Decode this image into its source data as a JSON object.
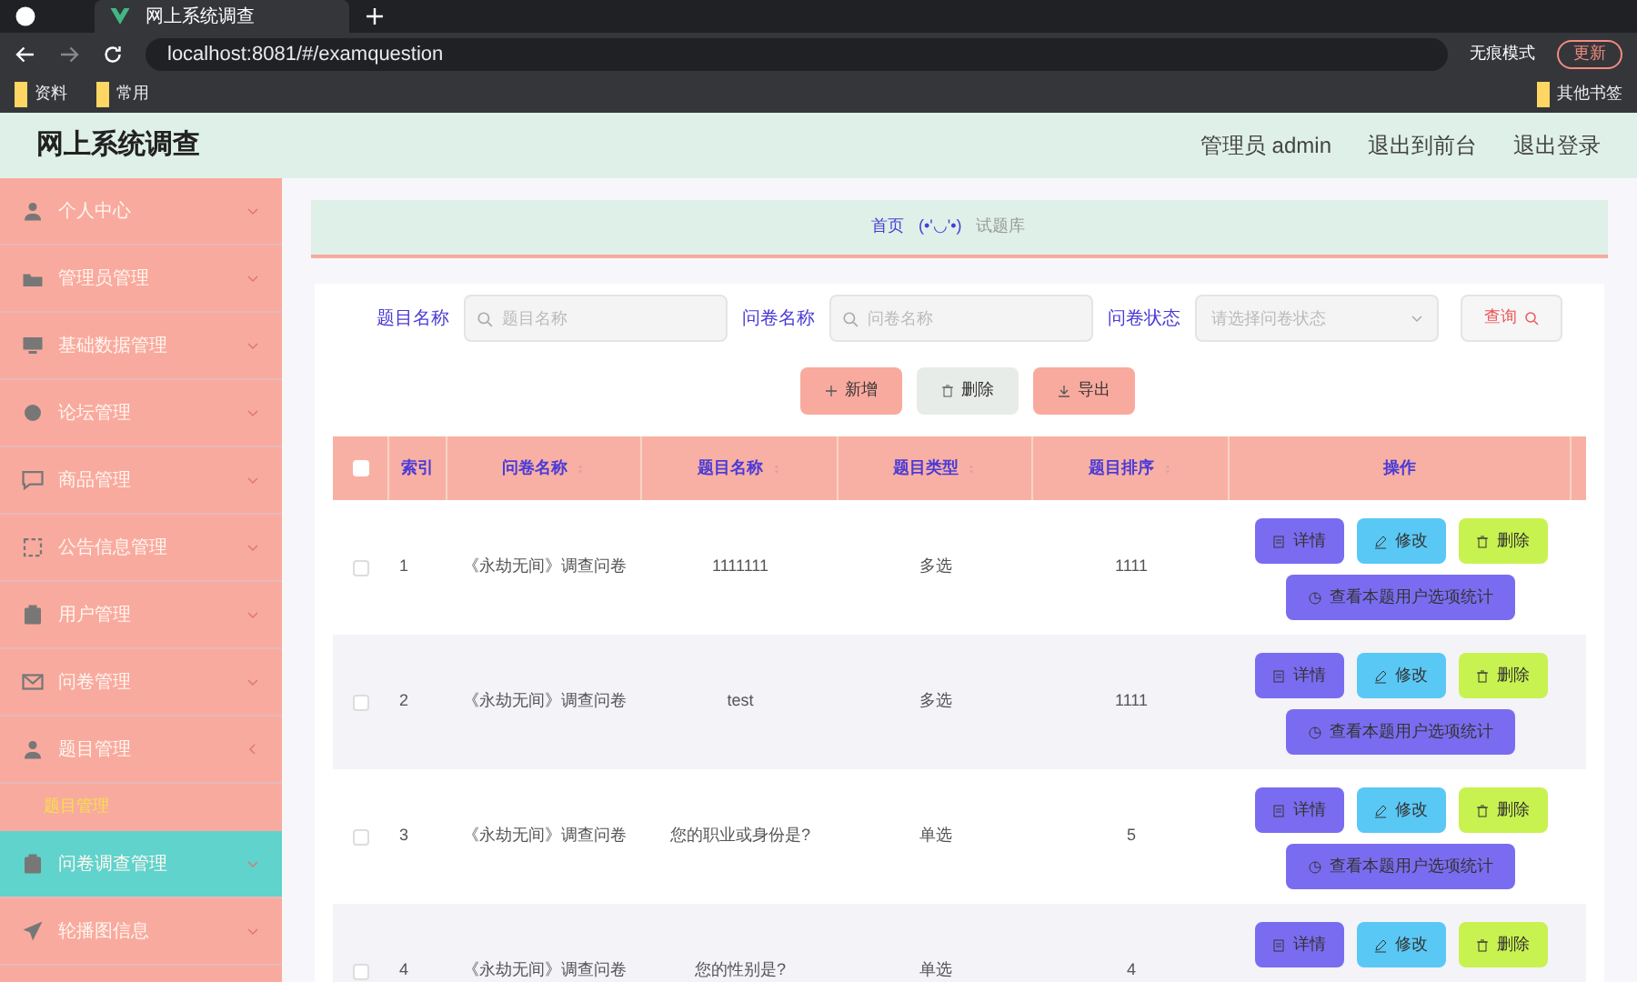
{
  "browser": {
    "tab_title": "网上系统调查",
    "url": "localhost:8081/#/examquestion",
    "incognito_label": "无痕模式",
    "update_label": "更新",
    "bookmarks": [
      "资料",
      "常用"
    ],
    "other_bookmarks": "其他书签"
  },
  "header": {
    "title": "网上系统调查",
    "links": [
      "管理员 admin",
      "退出到前台",
      "退出登录"
    ]
  },
  "sidebar": {
    "items": [
      {
        "label": "个人中心",
        "expanded": false,
        "selected": false
      },
      {
        "label": "管理员管理",
        "expanded": false,
        "selected": false
      },
      {
        "label": "基础数据管理",
        "expanded": false,
        "selected": false
      },
      {
        "label": "论坛管理",
        "expanded": false,
        "selected": false
      },
      {
        "label": "商品管理",
        "expanded": false,
        "selected": false
      },
      {
        "label": "公告信息管理",
        "expanded": false,
        "selected": false
      },
      {
        "label": "用户管理",
        "expanded": false,
        "selected": false
      },
      {
        "label": "问卷管理",
        "expanded": false,
        "selected": false
      },
      {
        "label": "题目管理",
        "expanded": true,
        "selected": false,
        "children": [
          {
            "label": "题目管理"
          }
        ]
      },
      {
        "label": "问卷调查管理",
        "expanded": false,
        "selected": true
      },
      {
        "label": "轮播图信息",
        "expanded": false,
        "selected": false
      }
    ]
  },
  "breadcrumb": {
    "home": "首页",
    "face": "(•'◡'•)",
    "current": "试题库"
  },
  "filters": [
    {
      "label": "题目名称",
      "kind": "search",
      "placeholder": "题目名称"
    },
    {
      "label": "问卷名称",
      "kind": "search",
      "placeholder": "问卷名称"
    },
    {
      "label": "问卷状态",
      "kind": "select",
      "placeholder": "请选择问卷状态"
    }
  ],
  "query_button": "查询",
  "toolbar": [
    {
      "label": "新增",
      "kind": "add"
    },
    {
      "label": "删除",
      "kind": "delete"
    },
    {
      "label": "导出",
      "kind": "export"
    }
  ],
  "table": {
    "select_all": {
      "checked": false
    },
    "columns": [
      "索引",
      "问卷名称",
      "题目名称",
      "题目类型",
      "题目排序",
      "操作"
    ],
    "rows": [
      {
        "index": "1",
        "survey": "《永劫无间》调查问卷",
        "question": "1111111",
        "type": "多选",
        "order": "1111",
        "checked": false,
        "actions": [
          {
            "label": "详情",
            "kind": "detail"
          },
          {
            "label": "修改",
            "kind": "edit"
          },
          {
            "label": "删除",
            "kind": "delete"
          },
          {
            "label": "查看本题用户选项统计",
            "kind": "stats"
          }
        ]
      },
      {
        "index": "2",
        "survey": "《永劫无间》调查问卷",
        "question": "test",
        "type": "多选",
        "order": "1111",
        "checked": false,
        "actions": [
          {
            "label": "详情",
            "kind": "detail"
          },
          {
            "label": "修改",
            "kind": "edit"
          },
          {
            "label": "删除",
            "kind": "delete"
          },
          {
            "label": "查看本题用户选项统计",
            "kind": "stats"
          }
        ]
      },
      {
        "index": "3",
        "survey": "《永劫无间》调查问卷",
        "question": "您的职业或身份是?",
        "type": "单选",
        "order": "5",
        "checked": false,
        "actions": [
          {
            "label": "详情",
            "kind": "detail"
          },
          {
            "label": "修改",
            "kind": "edit"
          },
          {
            "label": "删除",
            "kind": "delete"
          },
          {
            "label": "查看本题用户选项统计",
            "kind": "stats"
          }
        ]
      },
      {
        "index": "4",
        "survey": "《永劫无间》调查问卷",
        "question": "您的性别是?",
        "type": "单选",
        "order": "4",
        "checked": false,
        "actions": [
          {
            "label": "详情",
            "kind": "detail"
          },
          {
            "label": "修改",
            "kind": "edit"
          },
          {
            "label": "删除",
            "kind": "delete"
          }
        ]
      }
    ]
  }
}
